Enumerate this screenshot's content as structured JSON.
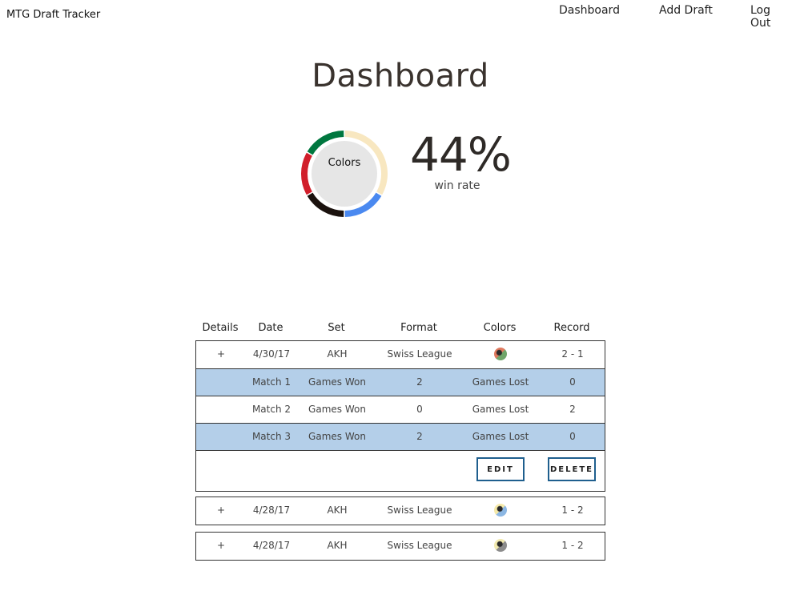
{
  "app": {
    "brand": "MTG Draft Tracker"
  },
  "nav": {
    "items": [
      "Dashboard",
      "Add Draft",
      "Log Out"
    ]
  },
  "page": {
    "title": "Dashboard"
  },
  "donut": {
    "label": "Colors",
    "segments": [
      {
        "color": "#f8e7c0",
        "value": 2
      },
      {
        "color": "#4a89f0",
        "value": 1
      },
      {
        "color": "#1b120e",
        "value": 1
      },
      {
        "color": "#d11f2b",
        "value": 1
      },
      {
        "color": "#00773f",
        "value": 1
      }
    ]
  },
  "stats": {
    "win_rate": "44%",
    "win_rate_label": "win rate"
  },
  "table": {
    "headers": [
      "Details",
      "Date",
      "Set",
      "Format",
      "Colors",
      "Record"
    ],
    "rows": [
      {
        "toggle": "+",
        "date": "4/30/17",
        "set": "AKH",
        "format": "Swiss League",
        "colors_icon": "red-green-mana-icon",
        "record": "2 - 1",
        "matches": [
          {
            "label": "Match 1",
            "won_label": "Games Won",
            "won": "2",
            "lost_label": "Games Lost",
            "lost": "0"
          },
          {
            "label": "Match 2",
            "won_label": "Games Won",
            "won": "0",
            "lost_label": "Games Lost",
            "lost": "2"
          },
          {
            "label": "Match 3",
            "won_label": "Games Won",
            "won": "2",
            "lost_label": "Games Lost",
            "lost": "0"
          }
        ],
        "edit_label": "EDIT",
        "delete_label": "DELETE"
      },
      {
        "toggle": "+",
        "date": "4/28/17",
        "set": "AKH",
        "format": "Swiss League",
        "colors_icon": "white-blue-mana-icon",
        "record": "1 - 2"
      },
      {
        "toggle": "+",
        "date": "4/28/17",
        "set": "AKH",
        "format": "Swiss League",
        "colors_icon": "white-black-mana-icon",
        "record": "1 - 2"
      }
    ]
  }
}
